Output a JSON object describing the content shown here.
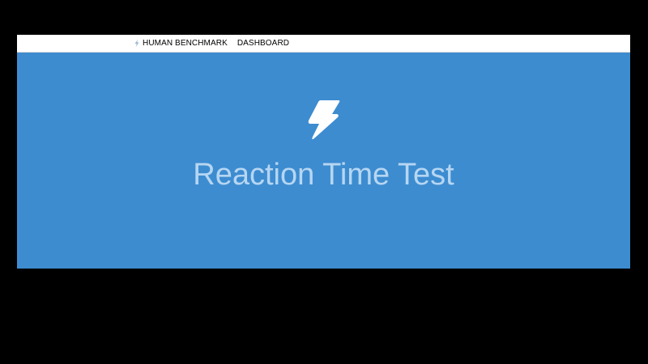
{
  "navbar": {
    "logo_label": "HUMAN BENCHMARK",
    "logo_icon": "bolt-icon",
    "links": [
      {
        "label": "DASHBOARD"
      }
    ]
  },
  "test": {
    "icon": "bolt-icon",
    "title": "Reaction Time Test"
  },
  "colors": {
    "background": "#000000",
    "navbar": "#ffffff",
    "test_area": "#3d8cd0",
    "title_text": "#b6d6f2",
    "icon": "#ffffff"
  }
}
